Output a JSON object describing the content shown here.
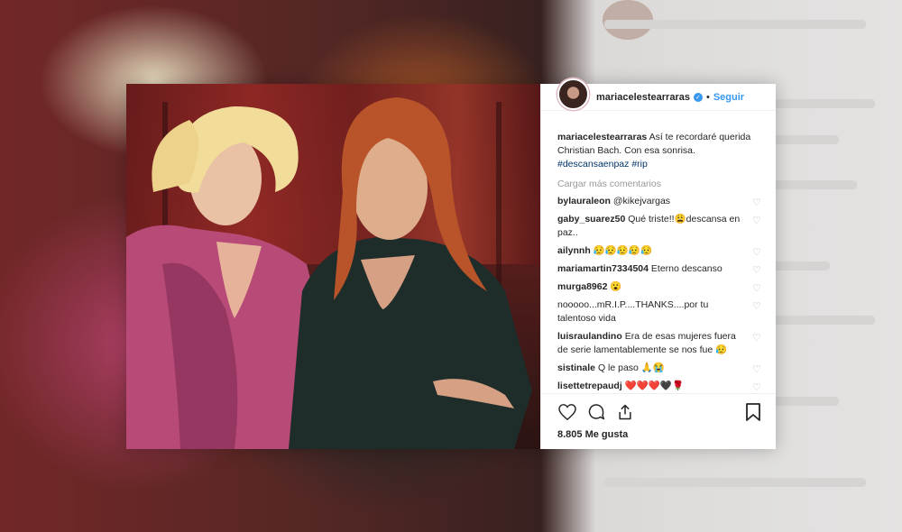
{
  "post": {
    "username": "mariacelestearraras",
    "follow_label": "Seguir",
    "dot": "•",
    "caption_user": "mariacelestearraras",
    "caption_text": "Así te recordaré querida Christian Bach. Con esa sonrisa.",
    "caption_tags": "#descansaenpaz #rip",
    "load_more": "Cargar más comentarios",
    "comments": [
      {
        "user": "bylauraleon",
        "text": "@kikejvargas"
      },
      {
        "user": "gaby_suarez50",
        "text": "Qué triste!!😩descansa en paz.."
      },
      {
        "user": "ailynnh",
        "text": "😥😥😥😥😥"
      },
      {
        "user": "mariamartin7334504",
        "text": "Eterno descanso"
      },
      {
        "user": "murga8962",
        "text": "😮"
      },
      {
        "user": "",
        "text": "nooooo...mR.I.P....THANKS....por tu talentoso vida"
      },
      {
        "user": "luisraulandino",
        "text": "Era de esas mujeres fuera de serie lamentablemente se nos fue 😥"
      },
      {
        "user": "sistinale",
        "text": "Q le paso 🙏😭"
      },
      {
        "user": "lisettetrepaudj",
        "text": "❤️❤️❤️🖤🌹"
      }
    ],
    "likes": "8.805 Me gusta",
    "heart_icon": "heart-icon",
    "comment_icon": "comment-icon",
    "share_icon": "share-icon",
    "save_icon": "bookmark-icon"
  }
}
